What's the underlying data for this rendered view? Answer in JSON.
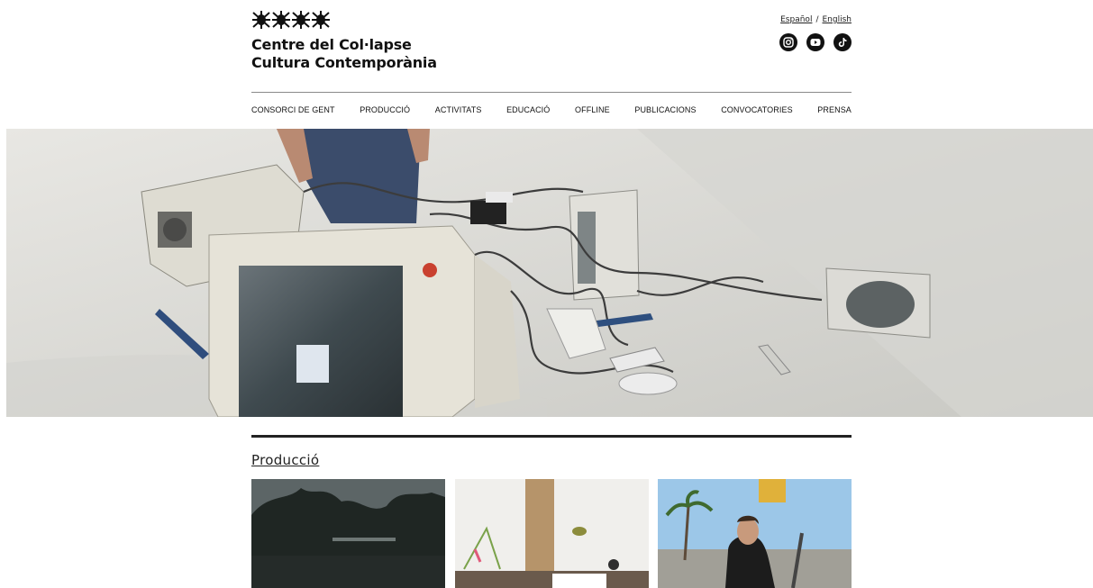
{
  "header": {
    "org_line1": "Centre del Col·lapse",
    "org_line2": "Cultura Contemporània",
    "lang_es": "Español",
    "lang_sep": "/",
    "lang_en": "English",
    "social": [
      "instagram-icon",
      "youtube-icon",
      "tiktok-icon"
    ]
  },
  "nav": {
    "items": [
      "CONSORCI DE GENT",
      "PRODUCCIÓ",
      "ACTIVITATS",
      "EDUCACIÓ",
      "OFFLINE",
      "PUBLICACIONS",
      "CONVOCATORIES",
      "PRENSA"
    ]
  },
  "section": {
    "title": "Producció"
  },
  "colors": {
    "text": "#111111",
    "rule": "#8a8a8a",
    "background": "#ffffff"
  }
}
